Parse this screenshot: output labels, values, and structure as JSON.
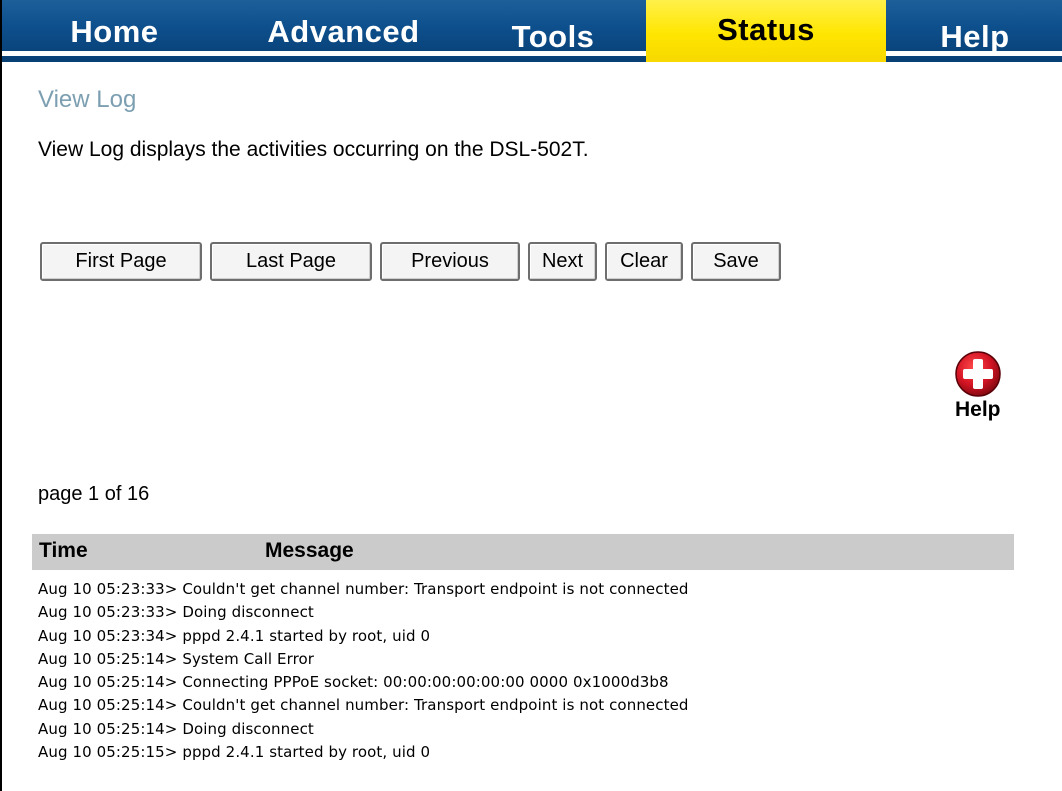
{
  "nav": {
    "tabs": [
      {
        "label": "Home",
        "active": false
      },
      {
        "label": "Advanced",
        "active": false
      },
      {
        "label": "Tools",
        "active": false
      },
      {
        "label": "Status",
        "active": true
      },
      {
        "label": "Help",
        "active": false
      }
    ]
  },
  "page": {
    "title": "View Log",
    "description": "View Log displays the activities occurring on the DSL-502T."
  },
  "buttons": {
    "first_page": "First Page",
    "last_page": "Last Page",
    "previous": "Previous",
    "next": "Next",
    "clear": "Clear",
    "save": "Save"
  },
  "help": {
    "icon": "plus-circle-icon",
    "label": "Help"
  },
  "pagination": {
    "text": "page 1 of 16"
  },
  "log": {
    "headers": {
      "time": "Time",
      "message": "Message"
    },
    "entries": [
      "Aug 10 05:23:33> Couldn't get channel number: Transport endpoint is not connected",
      "Aug 10 05:23:33> Doing disconnect",
      "Aug 10 05:23:34> pppd 2.4.1 started by root, uid 0",
      "Aug 10 05:25:14> System Call Error",
      "Aug 10 05:25:14> Connecting PPPoE socket: 00:00:00:00:00:00 0000 0x1000d3b8",
      "Aug 10 05:25:14> Couldn't get channel number: Transport endpoint is not connected",
      "Aug 10 05:25:14> Doing disconnect",
      "Aug 10 05:25:15> pppd 2.4.1 started by root, uid 0"
    ]
  },
  "colors": {
    "nav_blue": "#0d4f8c",
    "nav_active": "#ffe600",
    "title": "#7c9fb1",
    "log_header_bg": "#cbcbcb",
    "help_icon": "#cc1020"
  }
}
